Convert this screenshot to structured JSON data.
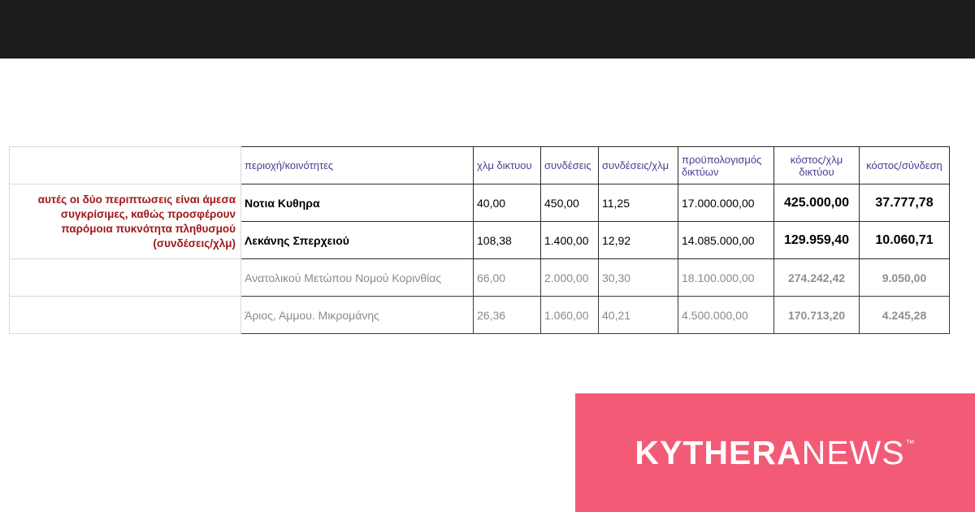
{
  "table": {
    "note": "αυτές οι δύο περιπτωσεις είναι άμεσα συγκρίσιμες, καθώς προσφέρουν παρόμοια πυκνότητα πληθυσμού (συνδέσεις/χλμ)",
    "headers": [
      "περιοχή/κοινότητες",
      "χλμ δικτυου",
      "συνδέσεις",
      "συνδέσεις/χλμ",
      "προϋπολογισμός δικτύων",
      "κόστος/χλμ δικτύου",
      "κόστος/σύνδεση"
    ],
    "rows": [
      [
        "Νοτια Κυθηρα",
        "40,00",
        "450,00",
        "11,25",
        "17.000.000,00",
        "425.000,00",
        "37.777,78"
      ],
      [
        "Λεκάνης Σπερχειού",
        "108,38",
        "1.400,00",
        "12,92",
        "14.085.000,00",
        "129.959,40",
        "10.060,71"
      ],
      [
        "Ανατολικού Μετώπου Νομού Κορινθίας",
        "66,00",
        "2.000,00",
        "30,30",
        "18.100.000,00",
        "274.242,42",
        "9.050,00"
      ],
      [
        "Άριος, Αμμου. Μικρομάνης",
        "26,36",
        "1.060,00",
        "40,21",
        "4.500.000,00",
        "170.713,20",
        "4.245,28"
      ]
    ]
  },
  "brand": {
    "bold": "KYTHERA",
    "light": "NEWS",
    "tm": "™",
    "color": "#f35a76"
  }
}
